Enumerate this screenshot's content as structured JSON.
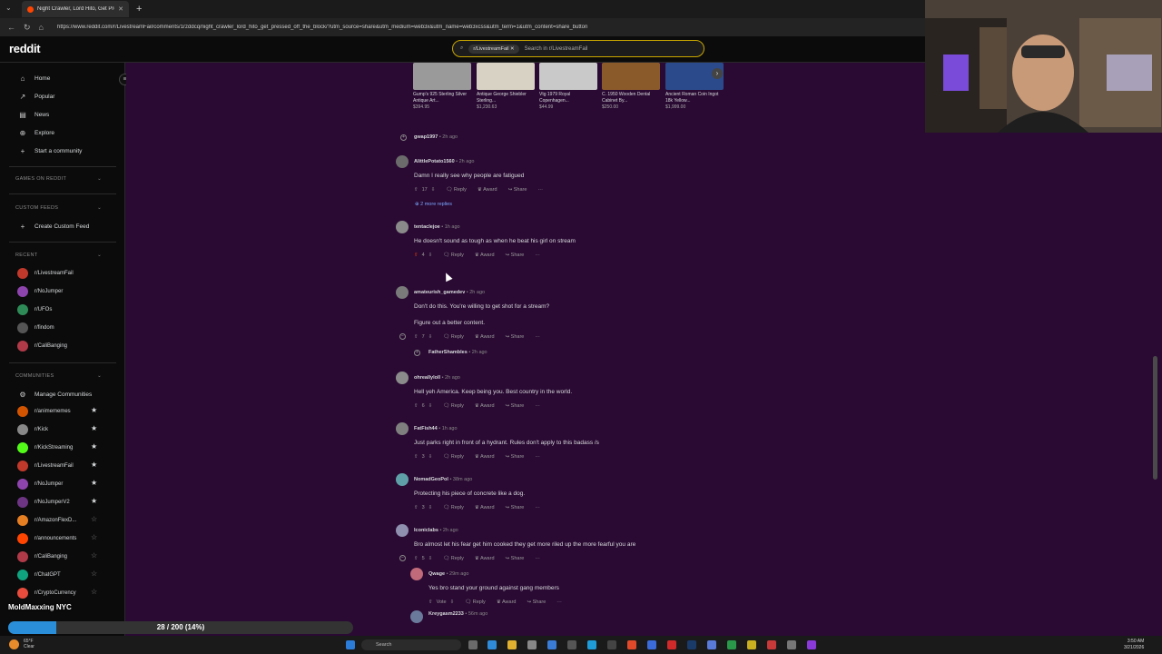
{
  "browser": {
    "tab_title": "Night Crawler, Lord Hito, Get Pre...",
    "url": "https://www.reddit.com/r/LivestreamFail/comments/1rzddcq/night_crawler_lord_hito_get_pressed_off_the_block/?utm_source=share&utm_medium=web3x&utm_name=web3xcss&utm_term=1&utm_content=share_button"
  },
  "header": {
    "logo": "reddit",
    "search_chip": "r/LivestreamFail",
    "search_placeholder": "Search in r/LivestreamFail"
  },
  "sidebar": {
    "nav": [
      {
        "label": "Home",
        "icon": "home-icon"
      },
      {
        "label": "Popular",
        "icon": "popular-icon"
      },
      {
        "label": "News",
        "icon": "news-icon"
      },
      {
        "label": "Explore",
        "icon": "explore-icon"
      },
      {
        "label": "Start a community",
        "icon": "plus-icon"
      }
    ],
    "games_title": "GAMES ON REDDIT",
    "custom_feeds_title": "CUSTOM FEEDS",
    "create_feed": "Create Custom Feed",
    "recent_title": "RECENT",
    "recent": [
      {
        "name": "r/LivestreamFail",
        "color": "#c0392b"
      },
      {
        "name": "r/NoJumper",
        "color": "#8e44ad"
      },
      {
        "name": "r/UFOs",
        "color": "#2e8b57"
      },
      {
        "name": "r/findom",
        "color": "#555555"
      },
      {
        "name": "r/CaliBanging",
        "color": "#b03a48"
      }
    ],
    "communities_title": "COMMUNITIES",
    "manage": "Manage Communities",
    "communities": [
      {
        "name": "r/animememes",
        "color": "#d35400",
        "starred": true
      },
      {
        "name": "r/Kick",
        "color": "#888888",
        "starred": true
      },
      {
        "name": "r/KickStreaming",
        "color": "#53fc18",
        "starred": true
      },
      {
        "name": "r/LivestreamFail",
        "color": "#c0392b",
        "starred": true
      },
      {
        "name": "r/NoJumper",
        "color": "#8e44ad",
        "starred": true
      },
      {
        "name": "r/NoJumperV2",
        "color": "#6c3483",
        "starred": true
      },
      {
        "name": "r/AmazonFlexD...",
        "color": "#e67e22",
        "starred": false
      },
      {
        "name": "r/announcements",
        "color": "#ff4500",
        "starred": false
      },
      {
        "name": "r/CaliBanging",
        "color": "#b03a48",
        "starred": false
      },
      {
        "name": "r/ChatGPT",
        "color": "#10a37f",
        "starred": false
      },
      {
        "name": "r/CryptoCurrency",
        "color": "#e74c3c",
        "starred": false
      }
    ]
  },
  "products": [
    {
      "title": "Gump's 925 Sterling Silver Antique Art...",
      "price": "$394.95",
      "color": "#9a9a9a"
    },
    {
      "title": "Antique George Shiebler Sterling...",
      "price": "$1,230.63",
      "color": "#d8d2c4"
    },
    {
      "title": "Vtg 1979 Royal Copenhagen...",
      "price": "$44.99",
      "color": "#c9c9c9"
    },
    {
      "title": "C. 1950 Wooden Dental Cabinet By...",
      "price": "$250.00",
      "color": "#8b5a2b"
    },
    {
      "title": "Ancient Roman Coin Ingot 18k Yellow...",
      "price": "$1,999.00",
      "color": "#2b4a8b"
    }
  ],
  "comments": [
    {
      "user": "gwap1997",
      "age": "2h ago"
    },
    {
      "user": "AlittlePotato1560",
      "age": "2h ago",
      "text": "Damn I really see why people are fatigued",
      "votes": "17",
      "more": "2 more replies"
    },
    {
      "user": "tentaclejoe",
      "age": "1h ago",
      "text": "He doesn't sound as tough as when he beat his girl on stream",
      "votes": "4"
    },
    {
      "user": "amateurish_gamedev",
      "age": "2h ago",
      "text": "Don't do this. You're willing to get shot for a stream?",
      "text2": "Figure out a better content.",
      "votes": "7"
    },
    {
      "user": "FatherShambles",
      "age": "2h ago"
    },
    {
      "user": "ohreallyloll",
      "age": "2h ago",
      "text": "Hell yeh America. Keep being you. Best country in the world.",
      "votes": "6"
    },
    {
      "user": "FatFish44",
      "age": "1h ago",
      "text": "Just parks right in front of a hydrant. Rules don't apply to this badass /s",
      "votes": "3"
    },
    {
      "user": "NomadGeoPol",
      "age": "38m ago",
      "text": "Protecting his piece of concrete like a dog.",
      "votes": "3"
    },
    {
      "user": "Iconiclabs",
      "age": "2h ago",
      "text": "Bro almost let his fear get him cooked they get more riled up the more fearful you are",
      "votes": "5"
    },
    {
      "user": "Qwage",
      "age": "29m ago",
      "text": "Yes bro stand your ground against gang members",
      "votes": "Vote"
    },
    {
      "user": "Kreygasm2233",
      "age": "56m ago"
    }
  ],
  "actions": {
    "reply": "Reply",
    "award": "Award",
    "share": "Share",
    "more": "···"
  },
  "overlay": {
    "streamer": "MoldMaxxing NYC",
    "progress_text": "28 / 200 (14%)",
    "progress_fraction": 0.14
  },
  "taskbar": {
    "search": "Search",
    "weather_temp": "65°F",
    "weather_cond": "Clear",
    "time": "3:50 AM",
    "date": "3/21/2026"
  }
}
